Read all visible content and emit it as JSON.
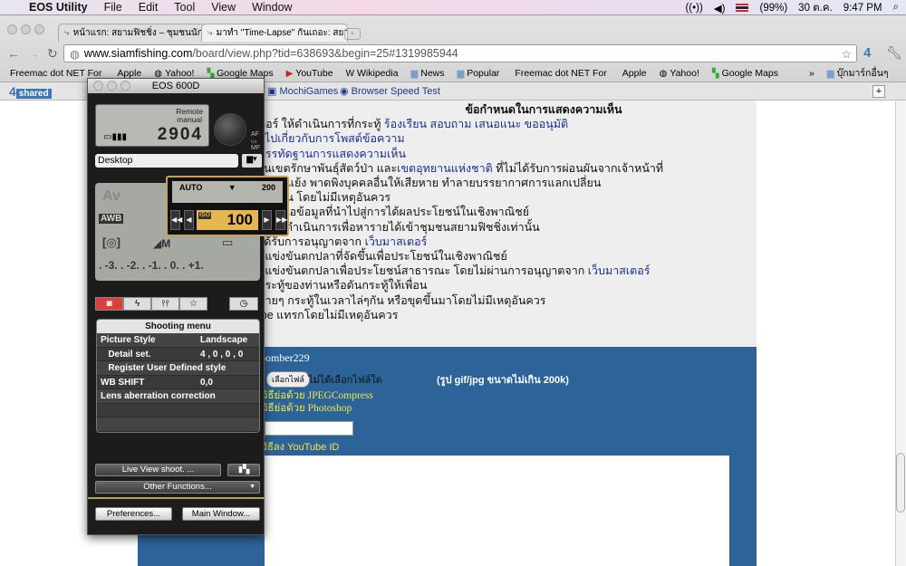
{
  "menubar": {
    "app": "EOS Utility",
    "items": [
      "File",
      "Edit",
      "Tool",
      "View",
      "Window"
    ],
    "battery": "(99%)",
    "date": "30 ต.ค.",
    "time": "9:47 PM"
  },
  "browser": {
    "tabs": [
      {
        "label": "หน้าแรก: สยามฟิชชิ่ง – ชุมชนนักตกปลา",
        "active": false
      },
      {
        "label": "มาทำ \"Time-Lapse\" กันเถอะ: สยาม",
        "active": true
      }
    ],
    "url_host": "www.siamfishing.com",
    "url_path": "/board/view.php?tid=638693&begin=25#1319985944",
    "bookmarks": [
      "Freemac dot NET For",
      "Apple",
      "Yahoo!",
      "Google Maps",
      "YouTube",
      "Wikipedia",
      "News",
      "Popular",
      "Freemac dot NET For",
      "Apple",
      "Yahoo!",
      "Google Maps"
    ],
    "other_bookmarks": "บุ๊กมาร์กอื่นๆ",
    "ext": {
      "shared": "shared",
      "mochi": "MochiGames",
      "speed": "Browser Speed Test"
    }
  },
  "page": {
    "rules_title": "ข้อกำหนดในการแสดงความเห็น",
    "rules": [
      [
        [
          "ตอร์ ให้ดำเนินการที่กระทู้ ",
          ""
        ],
        [
          "ร้องเรียน สอบถาม เสนอแนะ ขออนุมัติ",
          "b"
        ]
      ],
      [
        [
          "ัวไปเกี่ยวกับการโพสต์ข้อความ",
          "b"
        ]
      ],
      [
        [
          "บรรทัดฐานการแสดงความเห็น",
          "b"
        ]
      ],
      [
        [
          "ในเขตรักษาพันธุ์สัตว์ป่า และ",
          ""
        ],
        [
          "เขตอุทยานแห่งชาติ",
          "b"
        ],
        [
          " ที่ไม่ได้รับการผ่อนผันจากเจ้าหน้าที่",
          ""
        ]
      ],
      [
        [
          "ามขัดแย้ง พาดพิงบุคคลอื่นให้เสียหาย ทำลายบรรยากาศการแลกเปลี่ยน",
          ""
        ]
      ],
      [
        [
          "ไซต์อื่น โดยไม่มีเหตุอันควร",
          ""
        ]
      ],
      [
        [
          "รือเสนอข้อมูลที่นำไปสู่การได้ผลประโยชน์ในเชิงพาณิชย์",
          ""
        ]
      ],
      [
        [
          "นการดำเนินการเพื่อหารายได้เข้าชุมชนสยามฟิชชิ่งเท่านั้น",
          ""
        ]
      ],
      [
        [
          "ได้รับการอนุญาตจาก ",
          ""
        ],
        [
          "เว็บมาสเตอร์",
          "b"
        ]
      ],
      [
        [
          "ย์แข่งขันตกปลาที่จัดขึ้นเพื่อประโยชน์ในเชิงพาณิชย์",
          ""
        ]
      ],
      [
        [
          "ย์แข่งขันตกปลาเพื่อประโยชน์สาธารณะ โดยไม่ผ่านการอนุญาตจาก ",
          ""
        ],
        [
          "เว็บมาสเตอร์",
          "b"
        ]
      ],
      [
        [
          "กระทู้ของท่านหรือดันกระทู้ให้เพื่อน",
          ""
        ]
      ],
      [
        [
          "ลายๆ กระทู้ในเวลาไล่ๆกัน หรือขุดขึ้นมาโดยไม่มีเหตุอันควร",
          ""
        ]
      ],
      [
        [
          "ibe แทรกโดยไม่มีเหตุอันควร",
          ""
        ]
      ]
    ],
    "username": "bomber229",
    "choose_file": "เลือกไฟล์",
    "no_file": "ไม่ได้เลือกไฟล์ใด",
    "file_hint": "(รูป gif/jpg ขนาดไม่เกิน 200k)",
    "link1": "วิธีย่อด้วย JPEGCompress",
    "link2": "วิธีย่อด้วย Photoshop",
    "youtube_label": "วิธีลง YouTube ID",
    "youtube_value": ""
  },
  "eos": {
    "title": "EOS 600D",
    "mode": "Remote\nmanual",
    "shots": "2904",
    "destination": "Desktop",
    "iso_scale_left": "AUTO",
    "iso_scale_right": "200",
    "iso_label": "ISO",
    "iso_value": "100",
    "av": "Av",
    "wb": "AWB",
    "quality": "◢M",
    "exposure": ". -3. . -2. . -1. . 0. . +1.",
    "shooting_menu": "Shooting menu",
    "menu_rows": [
      [
        "Picture Style",
        "Landscape"
      ],
      [
        "   Detail set.",
        "4 , 0 , 0 , 0"
      ],
      [
        "   Register User Defined style",
        ""
      ],
      [
        "WB SHIFT",
        "0,0"
      ],
      [
        "Lens aberration correction",
        ""
      ],
      [
        "",
        ""
      ],
      [
        "",
        ""
      ]
    ],
    "live_view": "Live View shoot. ...",
    "other_functions": "Other Functions...",
    "preferences": "Preferences...",
    "main_window": "Main Window..."
  }
}
